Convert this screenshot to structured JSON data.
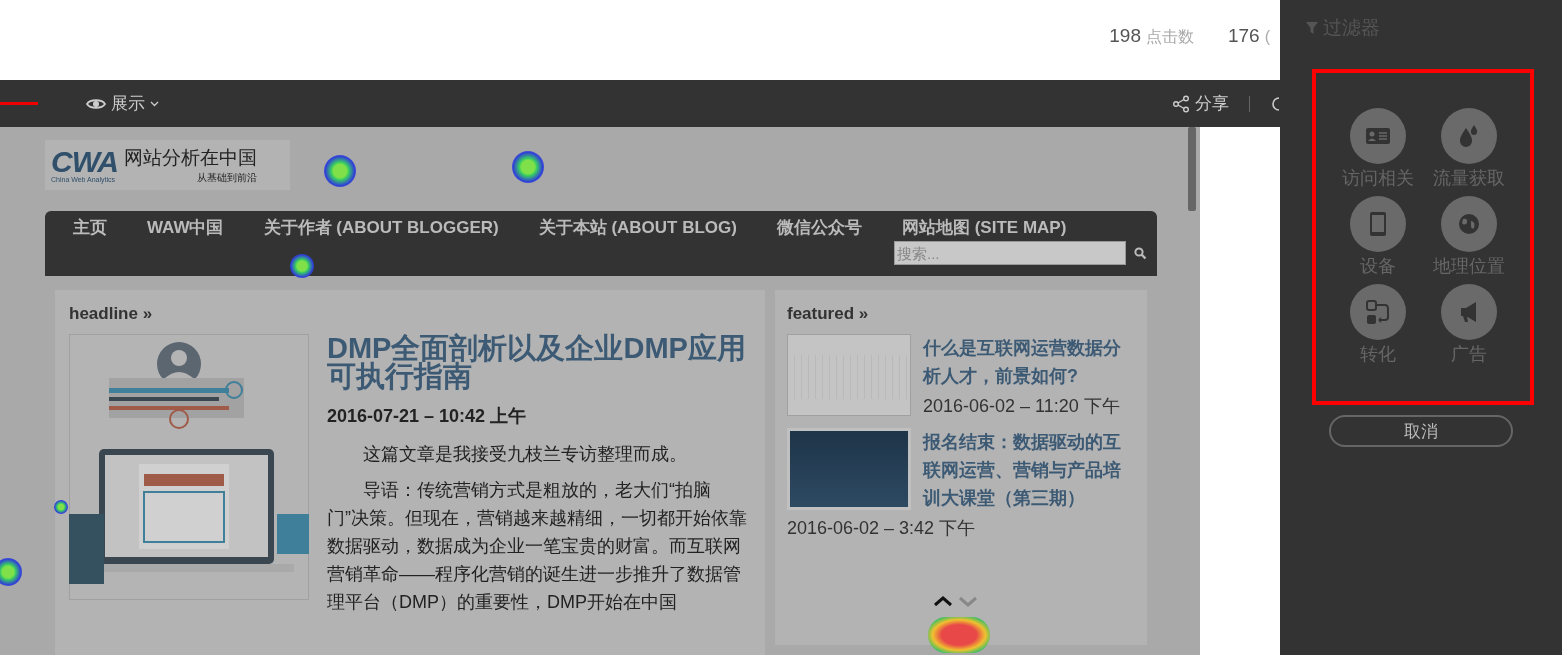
{
  "stats": [
    {
      "value": "198",
      "label": "点击数"
    },
    {
      "value": "176",
      "label": "("
    }
  ],
  "toolbar": {
    "display_menu": "展示",
    "share": "分享"
  },
  "filter": {
    "title": "过滤器",
    "categories": [
      {
        "label": "访问相关",
        "kind": "card"
      },
      {
        "label": "流量获取",
        "kind": "drops"
      },
      {
        "label": "设备",
        "kind": "tablet"
      },
      {
        "label": "地理位置",
        "kind": "globe"
      },
      {
        "label": "转化",
        "kind": "flow"
      },
      {
        "label": "广告",
        "kind": "megaphone"
      }
    ],
    "cancel": "取消"
  },
  "site": {
    "logo": {
      "mark": "CWA",
      "subtitle": "China Web Analytics",
      "name": "网站分析在中国",
      "tagline": "从基础到前沿"
    },
    "nav": [
      "主页",
      "WAW中国",
      "关于作者 (ABOUT BLOGGER)",
      "关于本站 (ABOUT BLOG)",
      "微信公众号",
      "网站地图 (SITE MAP)"
    ],
    "search": {
      "placeholder": "搜索..."
    },
    "headline": {
      "heading": "headline »",
      "title": "DMP全面剖析以及企业DMP应用可执行指南",
      "date": "2016-07-21 – 10:42 上午",
      "paragraphs": [
        "这篇文章是我接受九枝兰专访整理而成。",
        "导语：传统营销方式是粗放的，老大们“拍脑门”决策。但现在，营销越来越精细，一切都开始依靠数据驱动，数据成为企业一笔宝贵的财富。而互联网营销革命——程序化营销的诞生进一步推升了数据管理平台（DMP）的重要性，DMP开始在中国"
      ]
    },
    "featured": {
      "heading": "featured »",
      "posts": [
        {
          "title": "什么是互联网运营数据分析人才，前景如何?",
          "date": "2016-06-02 – 11:20 下午",
          "kind": "chart"
        },
        {
          "title": "报名结束：数据驱动的互联网运营、营销与产品培训大课堂（第三期）",
          "date": "2016-06-02 – 3:42 下午",
          "kind": "slide"
        }
      ]
    }
  }
}
